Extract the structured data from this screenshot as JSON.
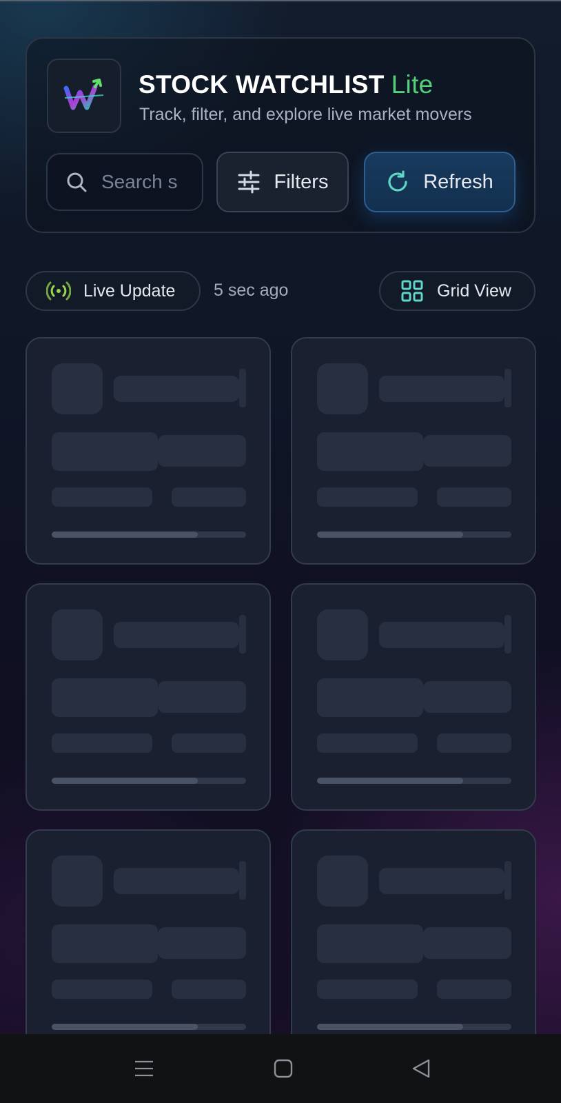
{
  "app": {
    "title": "STOCK WATCHLIST",
    "title_badge": "Lite",
    "subtitle": "Track, filter, and explore live market movers",
    "logo_icon": "trending-w-logo-icon"
  },
  "toolbar": {
    "search_placeholder": "Search s",
    "search_icon": "search-icon",
    "filters_label": "Filters",
    "filters_icon": "sliders-icon",
    "refresh_label": "Refresh",
    "refresh_icon": "refresh-icon"
  },
  "status": {
    "live_label": "Live Update",
    "live_icon": "broadcast-icon",
    "updated_ago": "5 sec ago",
    "view_label": "Grid View",
    "view_icon": "grid-icon"
  },
  "skeleton_cards": [
    {
      "progress": 0.75
    },
    {
      "progress": 0.75
    },
    {
      "progress": 0.75
    },
    {
      "progress": 0.75
    },
    {
      "progress": 0.75
    },
    {
      "progress": 0.75
    }
  ],
  "system_nav": {
    "items": [
      "menu-icon",
      "home-icon",
      "back-icon"
    ]
  },
  "colors": {
    "accent_green": "#52d17a",
    "refresh_blue": "#173a5e",
    "icon_teal": "#5fd6c8",
    "live_green": "#9ad84a"
  }
}
